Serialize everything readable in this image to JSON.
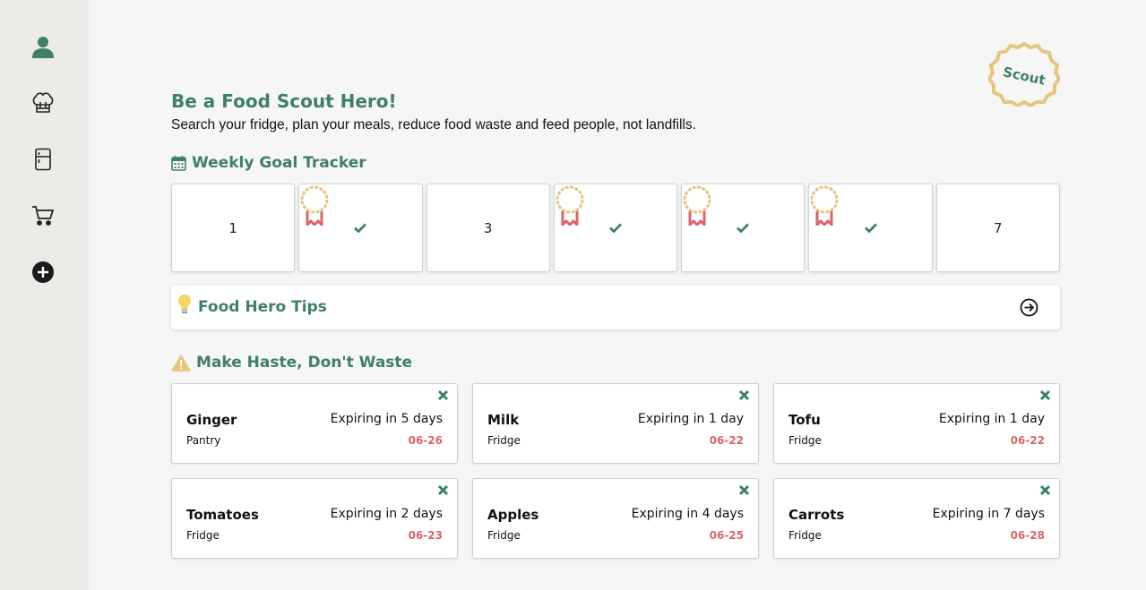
{
  "sidebar": {
    "items": [
      {
        "icon": "user-icon"
      },
      {
        "icon": "chef-hat-icon"
      },
      {
        "icon": "fridge-icon"
      },
      {
        "icon": "cart-icon"
      },
      {
        "icon": "add-circle-icon"
      }
    ]
  },
  "badge": {
    "text": "Scout"
  },
  "hero": {
    "title": "Be a Food Scout Hero!",
    "subtitle": "Search your fridge, plan your meals, reduce food waste and feed people, not landfills."
  },
  "tracker": {
    "title": "Weekly Goal Tracker",
    "days": [
      {
        "label": "1",
        "completed": false
      },
      {
        "label": "",
        "completed": true
      },
      {
        "label": "3",
        "completed": false
      },
      {
        "label": "",
        "completed": true
      },
      {
        "label": "",
        "completed": true
      },
      {
        "label": "",
        "completed": true
      },
      {
        "label": "7",
        "completed": false
      }
    ]
  },
  "tips": {
    "title": "Food Hero Tips"
  },
  "expiring": {
    "title": "Make Haste, Don't Waste",
    "items": [
      {
        "name": "Ginger",
        "location": "Pantry",
        "expiry": "Expiring in 5 days",
        "date": "06-26"
      },
      {
        "name": "Milk",
        "location": "Fridge",
        "expiry": "Expiring in 1 day",
        "date": "06-22"
      },
      {
        "name": "Tofu",
        "location": "Fridge",
        "expiry": "Expiring in 1 day",
        "date": "06-22"
      },
      {
        "name": "Tomatoes",
        "location": "Fridge",
        "expiry": "Expiring in 2 days",
        "date": "06-23"
      },
      {
        "name": "Apples",
        "location": "Fridge",
        "expiry": "Expiring in 4 days",
        "date": "06-25"
      },
      {
        "name": "Carrots",
        "location": "Fridge",
        "expiry": "Expiring in 7 days",
        "date": "06-28"
      }
    ]
  },
  "colors": {
    "accent": "#3e7f68",
    "badge": "#e8c57c",
    "ribbon": "#d9646a",
    "date": "#d9646a"
  }
}
